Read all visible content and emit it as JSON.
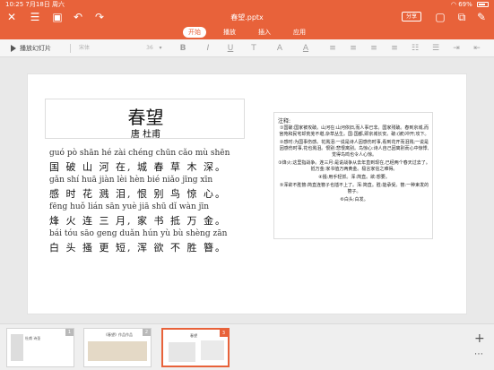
{
  "status": {
    "time": "10:25",
    "date": "7月18日 周六",
    "battery": "69%"
  },
  "header": {
    "title": "春望.pptx",
    "share_label": "分享",
    "tabs": [
      {
        "label": "开始",
        "active": true
      },
      {
        "label": "播放",
        "active": false
      },
      {
        "label": "插入",
        "active": false
      },
      {
        "label": "应用",
        "active": false
      }
    ]
  },
  "toolbar": {
    "play_label": "播放幻灯片",
    "font_name": "宋体",
    "font_size": "36",
    "bold": "B",
    "italic": "I",
    "underline": "U",
    "strikethrough": "T",
    "text_color": "A",
    "font_color_letter": "A"
  },
  "slide": {
    "title": "春望",
    "author": "唐 杜甫",
    "lines": [
      {
        "pinyin": "guó  pò  shān  hé  zài    chéng  chūn  cǎo  mù  shēn",
        "hanzi": "国 破 山 河 在,   城  春  草  木  深。"
      },
      {
        "pinyin": "gǎn  shí  huā  jiàn  lèi     hèn  bié  niǎo  jīng  xīn",
        "hanzi": "感 时 花  溅 泪,  恨 别  鸟  惊 心。"
      },
      {
        "pinyin": "fēng  huǒ  lián  sān  yuè     jiā  shū  dǐ  wàn  jīn",
        "hanzi": "烽 火  连 三 月,   家 书 抵 万 金。"
      },
      {
        "pinyin": "bái  tóu  sāo  geng  duǎn     hún  yù  bù  shèng  zān",
        "hanzi": "白 头 搔 更   短,  浑 欲 不  胜   簪。"
      }
    ],
    "notes_title": "注释:",
    "notes": [
      "①国破:国家被攻破。山河在:山河依旧,而人事已非。国家残破。春到京城,而宫苑和民宅却荒芜不堪,杂草丛生。国:国都,即京城长安。破:(被)冲开;攻下。",
      "②感时:为国事伤感。花溅泪:一说是诗人因感伤时事,看到花开而泪溅;一说是因感伤时事,花也溅泪。恨别:悲恨离别。鸟惊心:诗人自己因离别而心中惊悸,觉得鸟鸣也令人心惊。",
      "③烽火:这里指战争。连三月:是说战争从去年直到现在,已经两个春天过去了。抵万金:家书值万两黄金。极言家信之难得。",
      "④搔:用手轻抓。浑:简直。欲:想要。",
      "⑤浑欲不胜簪:简直连簪子也插不上了。浑:简直。胜:能承受。簪:一种束发的簪子。",
      "⑥白头:白发。"
    ]
  },
  "thumbnails": [
    {
      "number": "1",
      "label": "杜甫 诗圣",
      "selected": false
    },
    {
      "number": "2",
      "label": "《春望》作品作品",
      "selected": false
    },
    {
      "number": "3",
      "label": "春望",
      "selected": true
    }
  ],
  "colors": {
    "accent": "#e8623a",
    "toolbar_bg": "#f6f6f6",
    "canvas_bg": "#e9e9e9"
  }
}
